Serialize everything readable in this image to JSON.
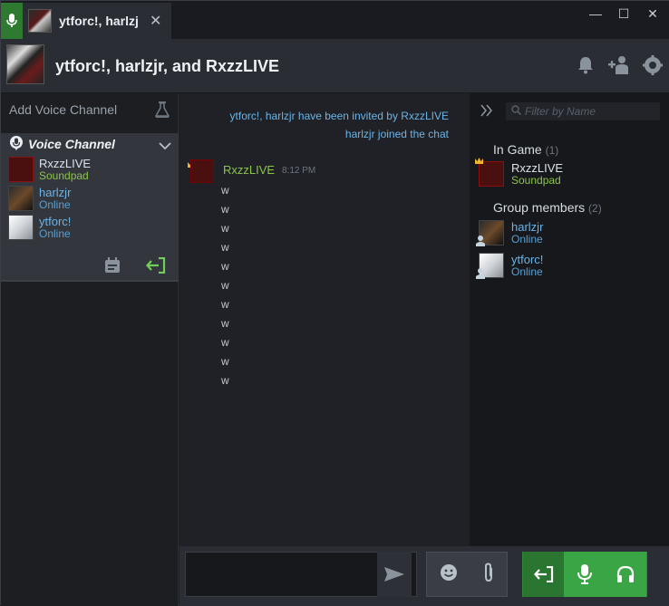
{
  "titlebar": {
    "tab_title": "ytforc!, harlzjr",
    "close_glyph": "✕",
    "minimize_glyph": "—",
    "maximize_glyph": "☐",
    "window_close_glyph": "✕"
  },
  "header": {
    "title": "ytforc!, harlzjr, and RxzzLIVE"
  },
  "left_panel": {
    "add_voice_channel": "Add Voice Channel",
    "voice_channel_title": "Voice Channel",
    "members": [
      {
        "name": "RxzzLIVE",
        "status": "Soundpad",
        "status_color": "#8bc34a",
        "name_color": "#d9e2ea"
      },
      {
        "name": "harlzjr",
        "status": "Online",
        "status_color": "#57a0d3",
        "name_color": "#6bb4e8"
      },
      {
        "name": "ytforc!",
        "status": "Online",
        "status_color": "#57a0d3",
        "name_color": "#6bb4e8"
      }
    ]
  },
  "chat": {
    "system_messages": [
      "ytforc!, harlzjr have been invited by RxzzLIVE",
      "harlzjr joined the chat"
    ],
    "message": {
      "author": "RxzzLIVE",
      "time": "8:12 PM",
      "lines": [
        "w",
        "w",
        "w",
        "w",
        "w",
        "w",
        "w",
        "w",
        "w",
        "w",
        "w"
      ]
    }
  },
  "members_panel": {
    "filter_placeholder": "Filter by Name",
    "in_game_label": "In Game",
    "in_game_count": "(1)",
    "group_label": "Group members",
    "group_count": "(2)",
    "in_game": [
      {
        "name": "RxzzLIVE",
        "status": "Soundpad",
        "color": "#8bc34a"
      }
    ],
    "group": [
      {
        "name": "harlzjr",
        "status": "Online",
        "color": "#57a0d3"
      },
      {
        "name": "ytforc!",
        "status": "Online",
        "color": "#57a0d3"
      }
    ]
  },
  "colors": {
    "accent_green": "#3aa545",
    "online_blue": "#57a0d3",
    "ingame_green": "#8bc34a"
  }
}
